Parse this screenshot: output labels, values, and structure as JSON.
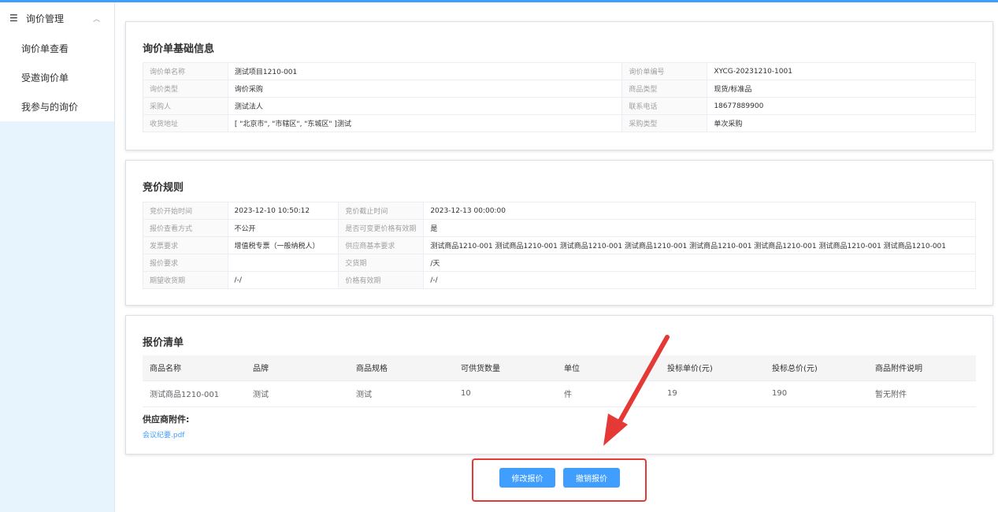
{
  "sidebar": {
    "menu_title": "询价管理",
    "items": [
      {
        "label": "询价单查看"
      },
      {
        "label": "受邀询价单"
      },
      {
        "label": "我参与的询价"
      }
    ]
  },
  "basic_info": {
    "title": "询价单基础信息",
    "rows": [
      {
        "l1": "询价单名称",
        "v1": "测试项目1210-001",
        "l2": "询价单编号",
        "v2": "XYCG-20231210-1001"
      },
      {
        "l1": "询价类型",
        "v1": "询价采购",
        "l2": "商品类型",
        "v2": "现货/标准品"
      },
      {
        "l1": "采购人",
        "v1": "测试法人",
        "l2": "联系电话",
        "v2": "18677889900"
      },
      {
        "l1": "收货地址",
        "v1": "[ \"北京市\", \"市辖区\", \"东城区\" ]测试",
        "l2": "采购类型",
        "v2": "单次采购"
      }
    ]
  },
  "bid_rules": {
    "title": "竞价规则",
    "rows": [
      {
        "l1": "竞价开始时间",
        "v1": "2023-12-10 10:50:12",
        "l2": "竞价截止时间",
        "v2": "2023-12-13 00:00:00"
      },
      {
        "l1": "报价查看方式",
        "v1": "不公开",
        "l2": "是否可变更价格有效期",
        "v2": "是"
      },
      {
        "l1": "发票要求",
        "v1": "增值税专票（一般纳税人）",
        "l2": "供应商基本要求",
        "v2": "测试商品1210-001 测试商品1210-001 测试商品1210-001 测试商品1210-001 测试商品1210-001 测试商品1210-001 测试商品1210-001 测试商品1210-001"
      },
      {
        "l1": "报价要求",
        "v1": "",
        "l2": "交货期",
        "v2": "/天"
      },
      {
        "l1": "期望收货期",
        "v1": "/-/",
        "l2": "价格有效期",
        "v2": "/-/"
      }
    ]
  },
  "quote_list": {
    "title": "报价清单",
    "headers": [
      "商品名称",
      "品牌",
      "商品规格",
      "可供货数量",
      "单位",
      "投标单价(元)",
      "投标总价(元)",
      "商品附件说明"
    ],
    "rows": [
      [
        "测试商品1210-001",
        "测试",
        "测试",
        "10",
        "件",
        "19",
        "190",
        "暂无附件"
      ]
    ],
    "attachments_label": "供应商附件:",
    "attachment_file": "会议纪要.pdf"
  },
  "actions": {
    "modify_label": "修改报价",
    "cancel_label": "撤销报价"
  },
  "colors": {
    "primary": "#409eff",
    "annotation": "#e53935"
  }
}
